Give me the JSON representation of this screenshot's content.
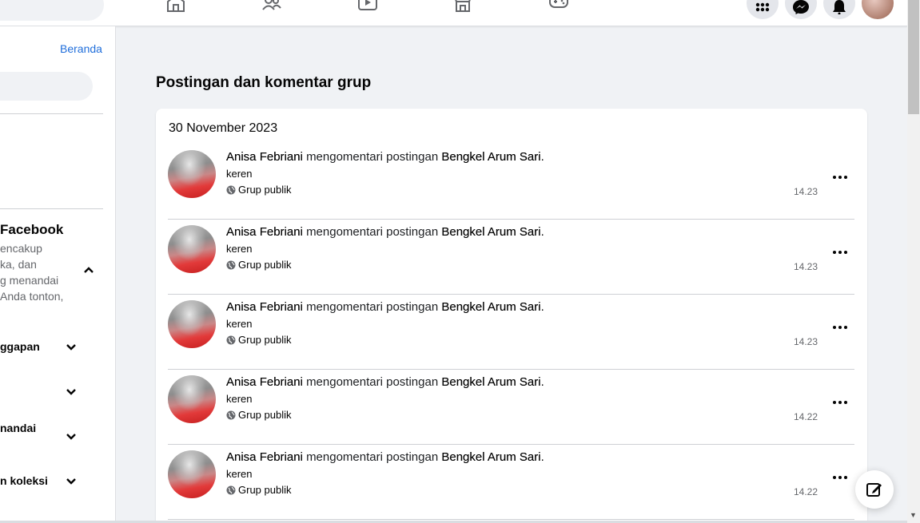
{
  "left_panel": {
    "home_link": "Beranda",
    "section_title": "Facebook",
    "section_desc": [
      "encakup",
      "ka, dan",
      "g menandai",
      "Anda tonton,"
    ],
    "items": [
      "ggapan",
      "",
      "nandai",
      "n koleksi"
    ]
  },
  "main": {
    "heading": "Postingan dan komentar grup",
    "date": "30 November 2023",
    "activities": [
      {
        "actor": "Anisa Febriani",
        "verb": "mengomentari postingan",
        "target": "Bengkel Arum Sari",
        "comment": "keren",
        "privacy": "Grup publik",
        "time": "14.23"
      },
      {
        "actor": "Anisa Febriani",
        "verb": "mengomentari postingan",
        "target": "Bengkel Arum Sari",
        "comment": "keren",
        "privacy": "Grup publik",
        "time": "14.23"
      },
      {
        "actor": "Anisa Febriani",
        "verb": "mengomentari postingan",
        "target": "Bengkel Arum Sari",
        "comment": "keren",
        "privacy": "Grup publik",
        "time": "14.23"
      },
      {
        "actor": "Anisa Febriani",
        "verb": "mengomentari postingan",
        "target": "Bengkel Arum Sari",
        "comment": "keren",
        "privacy": "Grup publik",
        "time": "14.22"
      },
      {
        "actor": "Anisa Febriani",
        "verb": "mengomentari postingan",
        "target": "Bengkel Arum Sari",
        "comment": "keren",
        "privacy": "Grup publik",
        "time": "14.22"
      }
    ]
  },
  "colors": {
    "link": "#216fdb",
    "background": "#f0f2f5",
    "card": "#ffffff"
  },
  "icons": [
    "home-icon",
    "friends-icon",
    "watch-icon",
    "marketplace-icon",
    "gaming-icon",
    "menu-grid-icon",
    "messenger-icon",
    "notifications-icon",
    "compose-icon"
  ]
}
